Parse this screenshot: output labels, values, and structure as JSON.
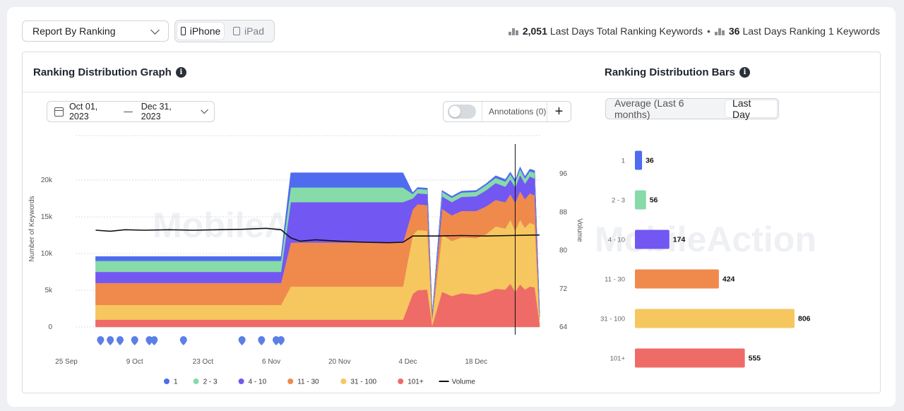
{
  "toolbar": {
    "report_select": "Report By Ranking",
    "devices": [
      {
        "label": "iPhone",
        "active": true
      },
      {
        "label": "iPad",
        "active": false
      }
    ],
    "summary": {
      "total_value": "2,051",
      "total_label": "Last Days Total Ranking Keywords",
      "separator": "•",
      "rank1_value": "36",
      "rank1_label": "Last Days Ranking 1 Keywords"
    }
  },
  "graph_section": {
    "title": "Ranking Distribution Graph",
    "date_start": "Oct 01, 2023",
    "date_dash": "—",
    "date_end": "Dec 31, 2023",
    "annotations_label": "Annotations (0)",
    "add_label": "+",
    "watermark": "MobileAction"
  },
  "bars_section": {
    "title": "Ranking Distribution Bars",
    "toggle": [
      {
        "label": "Average (Last 6 months)",
        "active": false
      },
      {
        "label": "Last Day",
        "active": true
      }
    ],
    "watermark": "MobileAction"
  },
  "colors": {
    "rank_1": "#4f6bf0",
    "rank_2_3": "#86dba8",
    "rank_4_10": "#7257f3",
    "rank_11_30": "#ef8a4c",
    "rank_31_100": "#f6c75f",
    "rank_101": "#ee6b67",
    "volume": "#111111",
    "annotation_pin": "#5b7fe6"
  },
  "chart_data": [
    {
      "type": "area",
      "stacked": true,
      "title": "Ranking Distribution Graph",
      "ylabel": "Number of Keywords",
      "y2label": "Volume",
      "ylim": [
        0,
        25000
      ],
      "y_ticks": [
        "0",
        "5k",
        "10k",
        "15k",
        "20k"
      ],
      "y_tick_values": [
        0,
        5000,
        10000,
        15000,
        20000
      ],
      "y2lim": [
        64,
        96
      ],
      "y2_ticks": [
        "64",
        "72",
        "80",
        "88",
        "96"
      ],
      "x_ticks": [
        "25 Sep",
        "9 Oct",
        "23 Oct",
        "6 Nov",
        "20 Nov",
        "4 Dec",
        "18 Dec"
      ],
      "x_tick_days": [
        -6,
        8,
        22,
        36,
        50,
        64,
        78
      ],
      "x_domain_days": [
        -6,
        91
      ],
      "grid": true,
      "legend_position": "bottom",
      "x_days": [
        0,
        5,
        10,
        15,
        20,
        25,
        30,
        35,
        38,
        40,
        45,
        50,
        55,
        60,
        63,
        65,
        66,
        68,
        69,
        71,
        73,
        75,
        78,
        80,
        82,
        84,
        85,
        86,
        87,
        88,
        89,
        90,
        91
      ],
      "series": [
        {
          "name": "101+",
          "color_key": "rank_101",
          "values": [
            1000,
            1000,
            1000,
            1000,
            1000,
            1000,
            1000,
            1000,
            1000,
            1000,
            1000,
            1000,
            1000,
            1000,
            1000,
            4500,
            5000,
            5100,
            200,
            4800,
            4200,
            4600,
            4400,
            4700,
            5200,
            5100,
            5900,
            4800,
            5800,
            5100,
            5500,
            5400,
            500
          ]
        },
        {
          "name": "31 - 100",
          "color_key": "rank_31_100",
          "values": [
            2000,
            2000,
            2000,
            2000,
            2000,
            2000,
            2000,
            2000,
            2000,
            4500,
            4500,
            4500,
            4500,
            4500,
            4500,
            8000,
            8200,
            8000,
            800,
            7800,
            7500,
            7600,
            7700,
            7900,
            8500,
            8300,
            8700,
            8300,
            8800,
            8400,
            8700,
            8500,
            500
          ]
        },
        {
          "name": "11 - 30",
          "color_key": "rank_11_30",
          "values": [
            3000,
            3000,
            3000,
            3000,
            3000,
            3000,
            3000,
            3000,
            3000,
            6000,
            6000,
            6000,
            6000,
            6000,
            6000,
            3500,
            3500,
            3500,
            300,
            3500,
            3500,
            3600,
            3700,
            3800,
            3600,
            3600,
            3500,
            3800,
            3900,
            3900,
            4000,
            4000,
            400
          ]
        },
        {
          "name": "4 - 10",
          "color_key": "rank_4_10",
          "values": [
            1500,
            1500,
            1500,
            1500,
            1500,
            1500,
            1500,
            1500,
            1500,
            5500,
            5500,
            5500,
            5500,
            5500,
            5500,
            1500,
            1500,
            1500,
            200,
            1700,
            1800,
            1900,
            2000,
            2200,
            2300,
            2100,
            2000,
            2100,
            2200,
            2100,
            2300,
            2300,
            300
          ]
        },
        {
          "name": "2 - 3",
          "color_key": "rank_2_3",
          "values": [
            1500,
            1500,
            1500,
            1500,
            1500,
            1500,
            1500,
            1500,
            1500,
            2000,
            2000,
            2000,
            2000,
            2000,
            2000,
            600,
            600,
            600,
            100,
            600,
            600,
            600,
            600,
            700,
            700,
            700,
            700,
            700,
            800,
            700,
            700,
            800,
            150
          ]
        },
        {
          "name": "1",
          "color_key": "rank_1",
          "values": [
            600,
            600,
            600,
            600,
            600,
            600,
            600,
            600,
            600,
            2000,
            2000,
            2000,
            2000,
            2000,
            2000,
            200,
            200,
            200,
            50,
            200,
            200,
            200,
            200,
            200,
            300,
            300,
            300,
            300,
            300,
            300,
            300,
            300,
            100
          ]
        }
      ],
      "volume_days": [
        0,
        3,
        6,
        10,
        15,
        20,
        25,
        30,
        35,
        38,
        40,
        42,
        45,
        50,
        55,
        60,
        63,
        65,
        70,
        75,
        80,
        85,
        90,
        91
      ],
      "volume_values": [
        84.2,
        84.0,
        84.3,
        84.2,
        84.3,
        84.2,
        84.3,
        84.4,
        84.6,
        84.3,
        82.6,
        81.9,
        82.2,
        81.9,
        81.7,
        81.6,
        81.7,
        83.0,
        83.0,
        83.1,
        83.0,
        83.1,
        83.2,
        83.2
      ],
      "volume_gap_days": [
        25,
        27
      ],
      "annotation_days": [
        1,
        3,
        5,
        8,
        11,
        12,
        18,
        30,
        34,
        37,
        38
      ],
      "cursor_day": 86,
      "legend": [
        {
          "name": "1",
          "color_key": "rank_1"
        },
        {
          "name": "2 - 3",
          "color_key": "rank_2_3"
        },
        {
          "name": "4 - 10",
          "color_key": "rank_4_10"
        },
        {
          "name": "11 - 30",
          "color_key": "rank_11_30"
        },
        {
          "name": "31 - 100",
          "color_key": "rank_31_100"
        },
        {
          "name": "101+",
          "color_key": "rank_101"
        },
        {
          "name": "Volume",
          "color_key": "volume",
          "line": true
        }
      ]
    },
    {
      "type": "bar",
      "orientation": "horizontal",
      "title": "Ranking Distribution Bars",
      "categories": [
        "1",
        "2 - 3",
        "4 - 10",
        "11 - 30",
        "31 - 100",
        "101+"
      ],
      "values": [
        36,
        56,
        174,
        424,
        806,
        555
      ],
      "color_keys": [
        "rank_1",
        "rank_2_3",
        "rank_4_10",
        "rank_11_30",
        "rank_31_100",
        "rank_101"
      ],
      "xlim": [
        0,
        806
      ]
    }
  ]
}
